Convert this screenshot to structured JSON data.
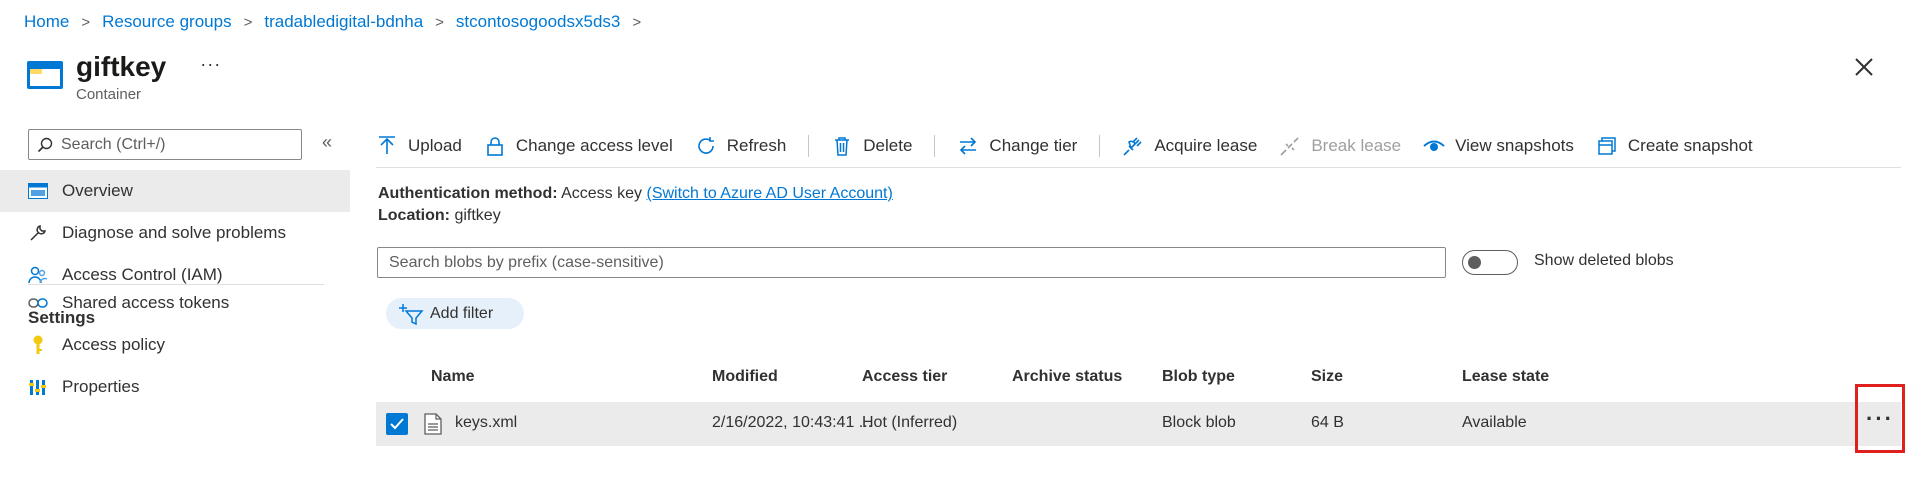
{
  "breadcrumb": {
    "items": [
      "Home",
      "Resource groups",
      "tradabledigital-bdnha",
      "stcontosogoodsx5ds3"
    ]
  },
  "header": {
    "title": "giftkey",
    "subtitle": "Container",
    "more": "···"
  },
  "sidebar": {
    "search_placeholder": "Search (Ctrl+/)",
    "collapse": "«",
    "items": [
      {
        "label": "Overview",
        "icon": "overview-icon",
        "active": true
      },
      {
        "label": "Diagnose and solve problems",
        "icon": "wrench-icon"
      },
      {
        "label": "Access Control (IAM)",
        "icon": "people-icon"
      }
    ],
    "section": "Settings",
    "settings_items": [
      {
        "label": "Shared access tokens",
        "icon": "link-icon"
      },
      {
        "label": "Access policy",
        "icon": "key-icon"
      },
      {
        "label": "Properties",
        "icon": "properties-icon"
      }
    ]
  },
  "toolbar": {
    "upload": "Upload",
    "change_access_level": "Change access level",
    "refresh": "Refresh",
    "delete": "Delete",
    "change_tier": "Change tier",
    "acquire_lease": "Acquire lease",
    "break_lease": "Break lease",
    "view_snapshots": "View snapshots",
    "create_snapshot": "Create snapshot"
  },
  "info": {
    "auth_label": "Authentication method:",
    "auth_value": "Access key",
    "auth_link": "(Switch to Azure AD User Account)",
    "location_label": "Location:",
    "location_value": "giftkey"
  },
  "blob_search": {
    "placeholder": "Search blobs by prefix (case-sensitive)",
    "show_deleted_label": "Show deleted blobs"
  },
  "filter": {
    "add_filter_label": "Add filter"
  },
  "table": {
    "columns": [
      "Name",
      "Modified",
      "Access tier",
      "Archive status",
      "Blob type",
      "Size",
      "Lease state"
    ],
    "rows": [
      {
        "name": "keys.xml",
        "modified": "2/16/2022, 10:43:41 ...",
        "access_tier": "Hot (Inferred)",
        "archive_status": "",
        "blob_type": "Block blob",
        "size": "64 B",
        "lease_state": "Available",
        "more": "···"
      }
    ]
  },
  "colors": {
    "accent": "#0078d4",
    "highlight_border": "#e01f1f",
    "selected_row": "#ebebeb"
  }
}
